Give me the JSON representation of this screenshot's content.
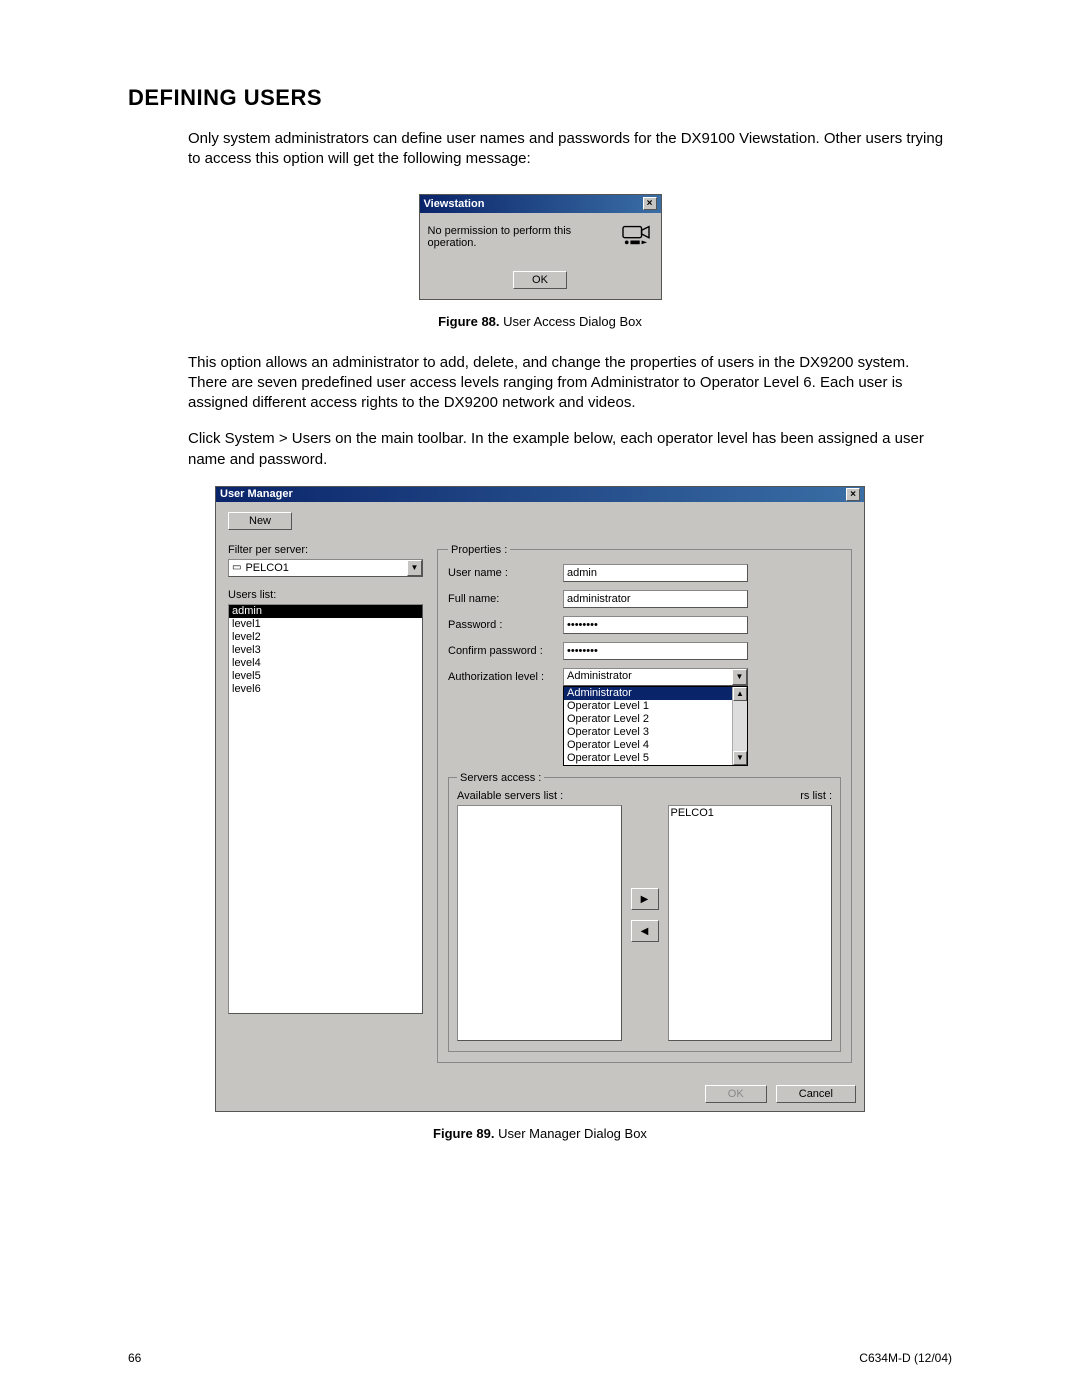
{
  "heading": "DEFINING USERS",
  "intro": "Only system administrators can define user names and passwords for the DX9100 Viewstation. Other users trying to access this option will get the following message:",
  "viewstation": {
    "title": "Viewstation",
    "message": "No permission to perform this operation.",
    "ok": "OK"
  },
  "caption88_bold": "Figure 88.",
  "caption88_text": "  User Access Dialog Box",
  "para2": "This option allows an administrator to add, delete, and change the properties of users in the DX9200 system. There are seven predefined user access levels ranging from Administrator to Operator Level 6. Each user is assigned different access rights to the DX9200 network and videos.",
  "para3": "Click System > Users on the main toolbar. In the example below, each operator level has been assigned a user name and password.",
  "usermgr": {
    "title": "User Manager",
    "new": "New",
    "filter_label": "Filter per server:",
    "filter_value": "PELCO1",
    "users_list_label": "Users list:",
    "users": [
      "admin",
      "level1",
      "level2",
      "level3",
      "level4",
      "level5",
      "level6"
    ],
    "selected_user_index": 0,
    "props_legend": "Properties :",
    "lbl_username": "User name :",
    "val_username": "admin",
    "lbl_fullname": "Full name:",
    "val_fullname": "administrator",
    "lbl_password": "Password :",
    "val_password": "xxxxxxxx",
    "lbl_confirm": "Confirm password :",
    "val_confirm": "xxxxxxxx",
    "lbl_auth": "Authorization level :",
    "val_auth": "Administrator",
    "auth_options": [
      "Administrator",
      "Operator Level 1",
      "Operator Level 2",
      "Operator Level 3",
      "Operator Level 4",
      "Operator Level 5"
    ],
    "servers_legend": "Servers access :",
    "lbl_avail": "Available servers list :",
    "lbl_assigned_suffix": "rs list :",
    "assigned_server": "PELCO1",
    "ok": "OK",
    "cancel": "Cancel"
  },
  "caption89_bold": "Figure 89.",
  "caption89_text": "  User Manager Dialog Box",
  "footer_left": "66",
  "footer_right": "C634M-D (12/04)"
}
